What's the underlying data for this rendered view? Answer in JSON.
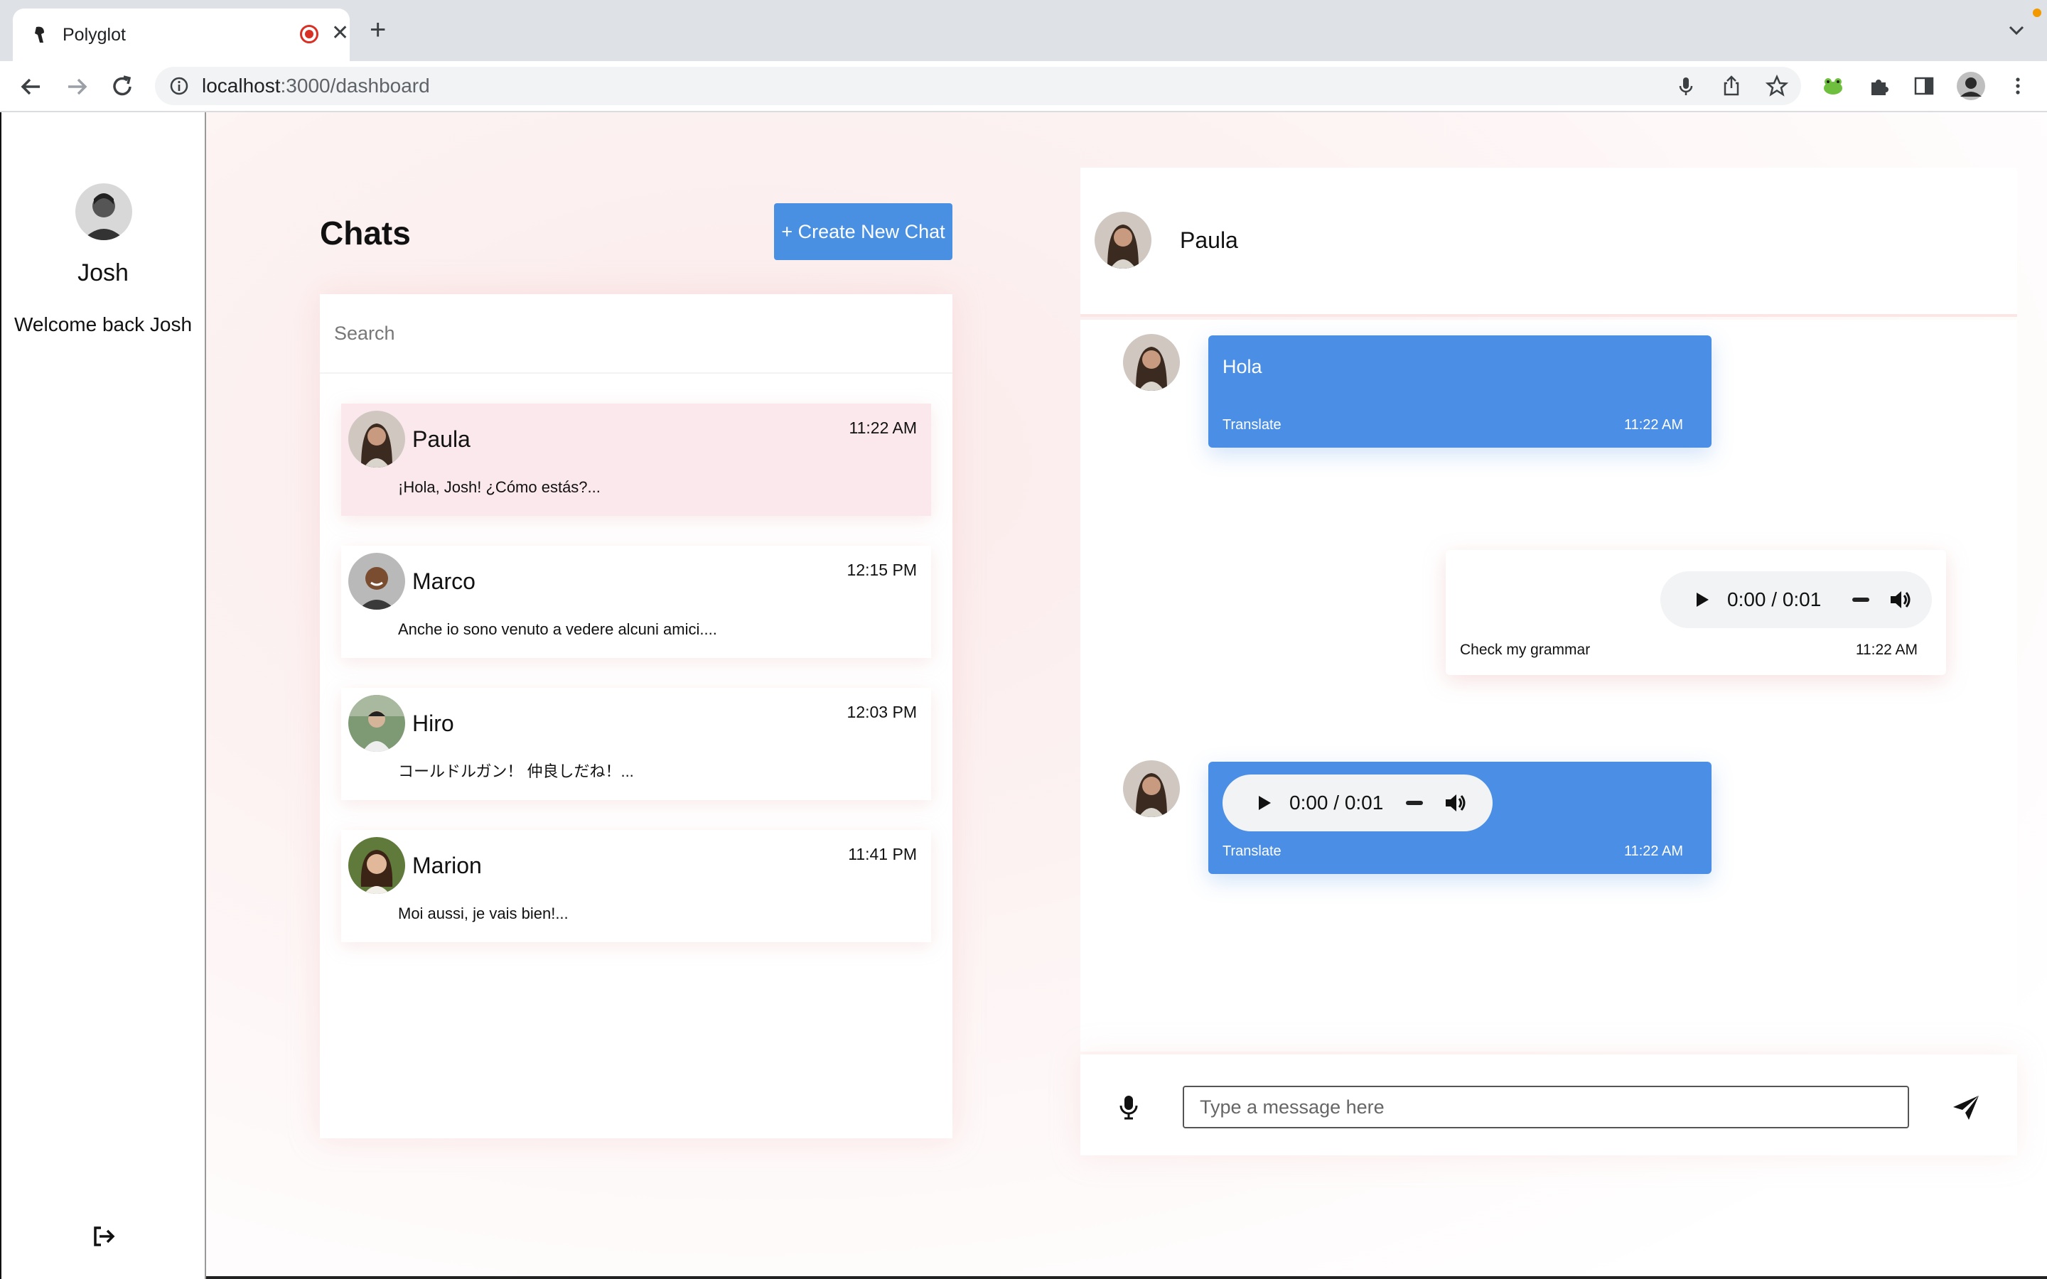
{
  "browser": {
    "tab_title": "Polyglot",
    "url_host": "localhost",
    "url_path": ":3000/dashboard"
  },
  "sidebar": {
    "username": "Josh",
    "welcome": "Welcome back Josh"
  },
  "chats": {
    "title": "Chats",
    "create_button": "+ Create New Chat",
    "search_placeholder": "Search",
    "items": [
      {
        "name": "Paula",
        "time": "11:22 AM",
        "preview": "¡Hola, Josh! ¿Cómo estás?...",
        "active": true
      },
      {
        "name": "Marco",
        "time": "12:15 PM",
        "preview": "Anche io sono venuto a vedere alcuni amici....",
        "active": false
      },
      {
        "name": "Hiro",
        "time": "12:03 PM",
        "preview": "コールドルガン！ 仲良しだね！...",
        "active": false
      },
      {
        "name": "Marion",
        "time": "11:41 PM",
        "preview": "Moi aussi, je vais bien!...",
        "active": false
      }
    ]
  },
  "conversation": {
    "contact_name": "Paula",
    "messages": [
      {
        "text": "Hola",
        "action": "Translate",
        "time": "11:22 AM"
      },
      {
        "audio_time": "0:00 / 0:01",
        "action": "Check my grammar",
        "time": "11:22 AM"
      },
      {
        "audio_time": "0:00 / 0:01",
        "action": "Translate",
        "time": "11:22 AM"
      }
    ],
    "input_placeholder": "Type a message here"
  },
  "colors": {
    "accent": "#4a90e2",
    "active_chat": "#fbe8ec",
    "background_tint": "#fbeaea"
  },
  "icons": [
    "mic-icon",
    "send-icon",
    "logout-icon",
    "play-icon",
    "volume-icon",
    "back-icon",
    "forward-icon",
    "reload-icon",
    "star-icon",
    "share-icon",
    "extensions-icon",
    "menu-icon"
  ]
}
